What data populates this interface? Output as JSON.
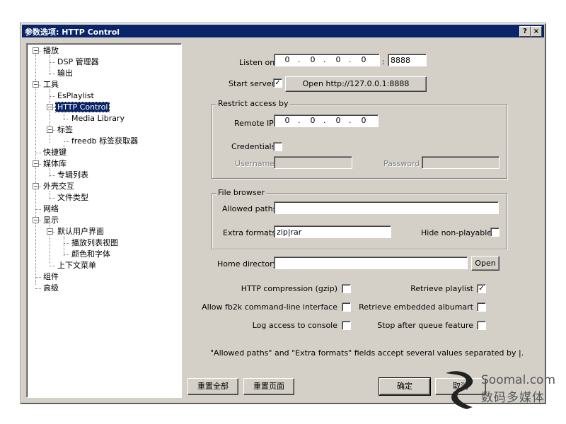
{
  "window": {
    "title": "参数选项: HTTP Control",
    "help_btn": "?",
    "close_btn": "×"
  },
  "tree": [
    {
      "label": "播放",
      "expander": "−"
    },
    {
      "label": "DSP 管理器"
    },
    {
      "label": "输出"
    },
    {
      "label": "工具",
      "expander": "−"
    },
    {
      "label": "EsPlaylist"
    },
    {
      "label": "HTTP Control",
      "expander": "−",
      "selected": true
    },
    {
      "label": "Media Library"
    },
    {
      "label": "标签",
      "expander": "−"
    },
    {
      "label": "freedb 标签获取器"
    },
    {
      "label": "快捷键"
    },
    {
      "label": "媒体库",
      "expander": "−"
    },
    {
      "label": "专辑列表"
    },
    {
      "label": "外壳交互",
      "expander": "−"
    },
    {
      "label": "文件类型"
    },
    {
      "label": "网络"
    },
    {
      "label": "显示",
      "expander": "−"
    },
    {
      "label": "默认用户界面",
      "expander": "−"
    },
    {
      "label": "播放列表视图"
    },
    {
      "label": "颜色和字体"
    },
    {
      "label": "上下文菜单"
    },
    {
      "label": "组件"
    },
    {
      "label": "高级"
    }
  ],
  "server": {
    "listen_on_label": "Listen on",
    "ip": [
      "0",
      "0",
      "0",
      "0"
    ],
    "port_sep": ":",
    "port": "8888",
    "start_server_label": "Start server",
    "start_server_checked": "✓",
    "open_button": "Open http://127.0.0.1:8888"
  },
  "restrict": {
    "group_title": "Restrict access by",
    "remote_ip_label": "Remote IP",
    "remote_ip": [
      "0",
      "0",
      "0",
      "0"
    ],
    "credentials_label": "Credentials",
    "username_label": "Username",
    "username_value": "",
    "password_label": "Password",
    "password_value": ""
  },
  "file_browser": {
    "group_title": "File browser",
    "allowed_paths_label": "Allowed paths",
    "allowed_paths_value": "",
    "extra_formats_label": "Extra formats",
    "extra_formats_value": "zip|rar",
    "hide_nonplayables_label": "Hide non-playables"
  },
  "home": {
    "label": "Home directory",
    "value": "",
    "open_button": "Open"
  },
  "options": {
    "http_compression_label": "HTTP compression (gzip)",
    "allow_cmdline_label": "Allow fb2k command-line interface",
    "log_access_label": "Log access to console",
    "retrieve_playlist_label": "Retrieve playlist",
    "retrieve_playlist_checked": "✓",
    "retrieve_albumart_label": "Retrieve embedded albumart",
    "stop_after_queue_label": "Stop after queue feature"
  },
  "note": "\"Allowed paths\" and \"Extra formats\" fields accept several values separated by |.",
  "footer": {
    "reset_all": "重置全部",
    "reset_page": "重置页面",
    "ok": "确定",
    "cancel": "取消"
  },
  "watermark": {
    "line1": "Soomal.com",
    "line2": "数码多媒体"
  }
}
